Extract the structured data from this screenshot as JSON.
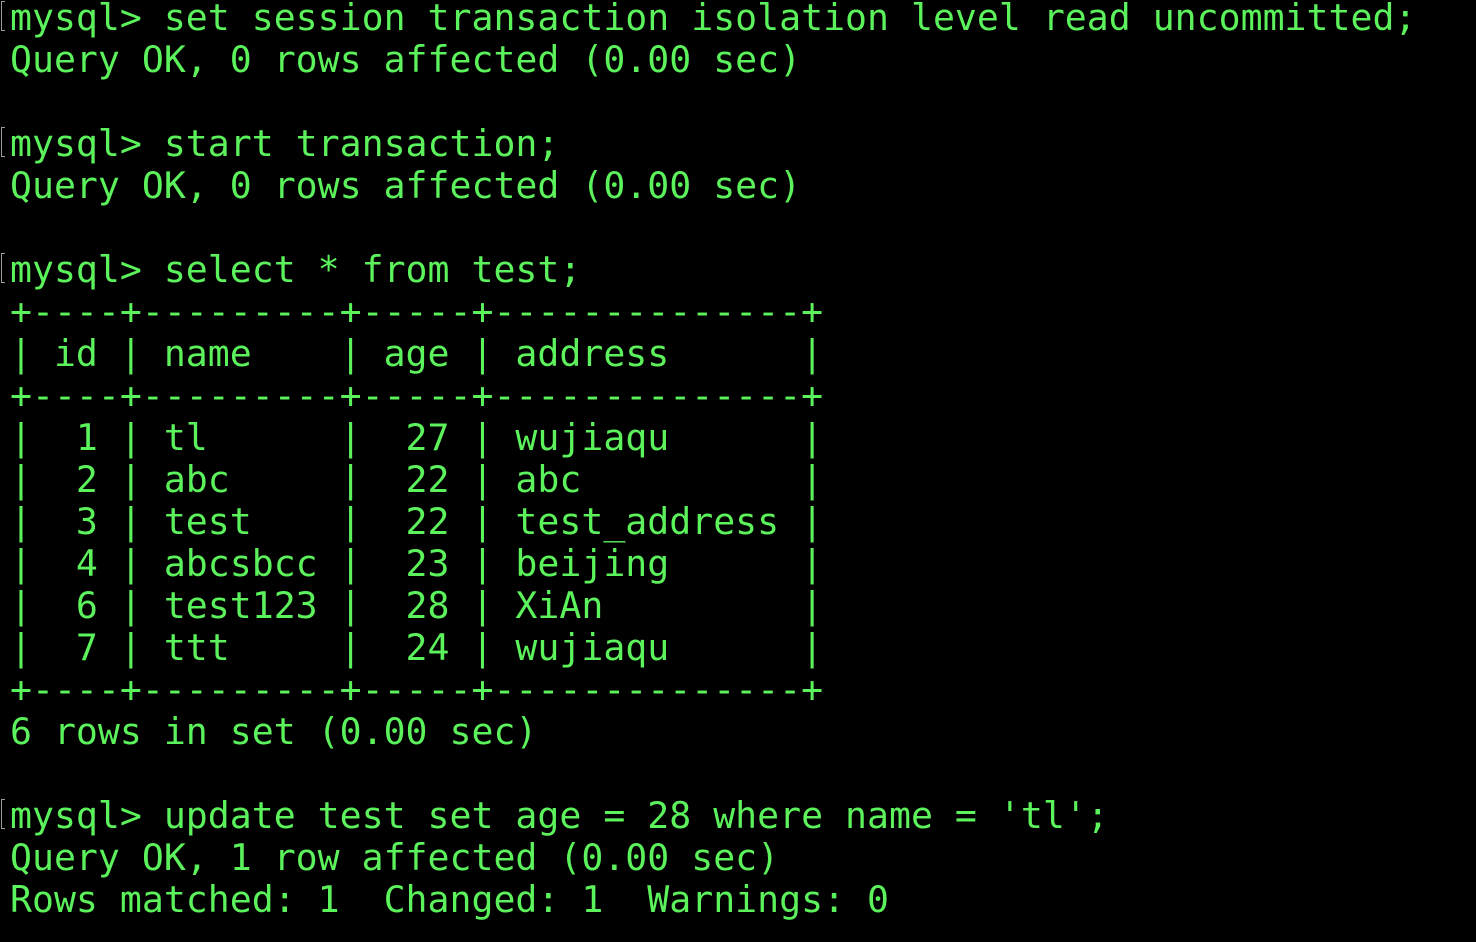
{
  "terminal": {
    "foreground": "#5cf25c",
    "background": "#000000",
    "prompt": "mysql> ",
    "lines": [
      {
        "type": "command",
        "text": "set session transaction isolation level read uncommitted;"
      },
      {
        "type": "output",
        "text": "Query OK, 0 rows affected (0.00 sec)"
      },
      {
        "type": "blank",
        "text": ""
      },
      {
        "type": "command",
        "text": "start transaction;"
      },
      {
        "type": "output",
        "text": "Query OK, 0 rows affected (0.00 sec)"
      },
      {
        "type": "blank",
        "text": ""
      },
      {
        "type": "command",
        "text": "select * from test;"
      },
      {
        "type": "table",
        "text": "+----+---------+-----+--------------+"
      },
      {
        "type": "table",
        "text": "| id | name    | age | address      |"
      },
      {
        "type": "table",
        "text": "+----+---------+-----+--------------+"
      },
      {
        "type": "table",
        "text": "|  1 | tl      |  27 | wujiaqu      |"
      },
      {
        "type": "table",
        "text": "|  2 | abc     |  22 | abc          |"
      },
      {
        "type": "table",
        "text": "|  3 | test    |  22 | test_address |"
      },
      {
        "type": "table",
        "text": "|  4 | abcsbcc |  23 | beijing      |"
      },
      {
        "type": "table",
        "text": "|  6 | test123 |  28 | XiAn         |"
      },
      {
        "type": "table",
        "text": "|  7 | ttt     |  24 | wujiaqu      |"
      },
      {
        "type": "table",
        "text": "+----+---------+-----+--------------+"
      },
      {
        "type": "output",
        "text": "6 rows in set (0.00 sec)"
      },
      {
        "type": "blank",
        "text": ""
      },
      {
        "type": "command",
        "text": "update test set age = 28 where name = 'tl';"
      },
      {
        "type": "output",
        "text": "Query OK, 1 row affected (0.00 sec)"
      },
      {
        "type": "output",
        "text": "Rows matched: 1  Changed: 1  Warnings: 0"
      }
    ]
  }
}
